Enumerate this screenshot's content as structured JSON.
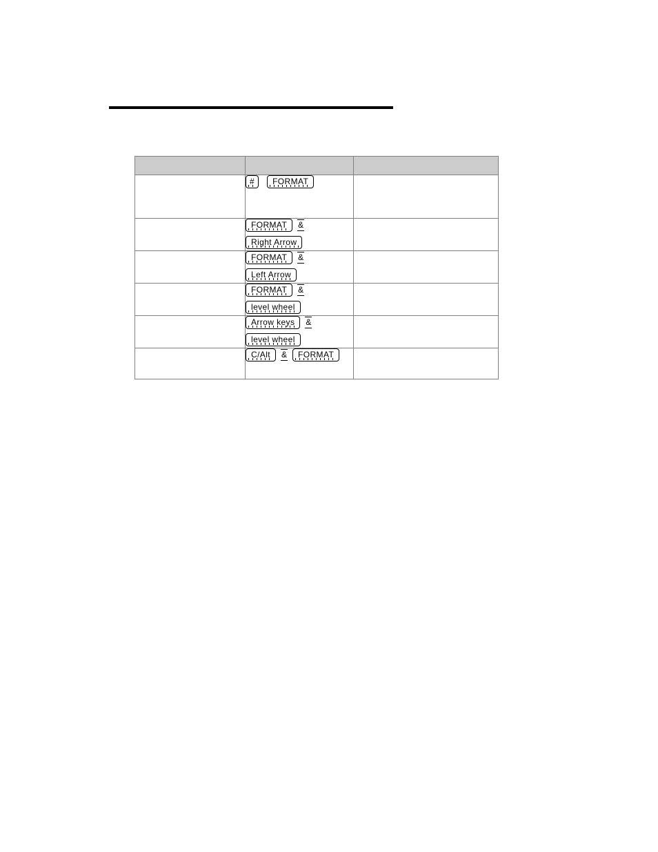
{
  "page": {
    "divider": "horizontal-rule"
  },
  "table": {
    "headers": [
      "",
      "",
      ""
    ],
    "rows": [
      {
        "action": "",
        "keys": [
          {
            "items": [
              {
                "type": "key",
                "label": "#"
              },
              {
                "type": "gap"
              },
              {
                "type": "key",
                "label": "FORMAT"
              }
            ]
          }
        ],
        "notes": "",
        "height": "tall"
      },
      {
        "action": "",
        "keys": [
          {
            "items": [
              {
                "type": "key",
                "label": "FORMAT"
              },
              {
                "type": "amp",
                "label": "&"
              }
            ]
          },
          {
            "items": [
              {
                "type": "key",
                "label": "Right Arrow"
              }
            ]
          }
        ],
        "notes": "",
        "height": "double"
      },
      {
        "action": "",
        "keys": [
          {
            "items": [
              {
                "type": "key",
                "label": "FORMAT"
              },
              {
                "type": "amp",
                "label": "&"
              }
            ]
          },
          {
            "items": [
              {
                "type": "key",
                "label": "Left Arrow"
              }
            ]
          }
        ],
        "notes": "",
        "height": "double"
      },
      {
        "action": "",
        "keys": [
          {
            "items": [
              {
                "type": "key",
                "label": "FORMAT"
              },
              {
                "type": "amp",
                "label": "&"
              }
            ]
          },
          {
            "items": [
              {
                "type": "key",
                "label": "level wheel"
              }
            ]
          }
        ],
        "notes": "",
        "height": "double"
      },
      {
        "action": "",
        "keys": [
          {
            "items": [
              {
                "type": "key",
                "label": "Arrow keys"
              },
              {
                "type": "amp",
                "label": "&"
              }
            ]
          },
          {
            "items": [
              {
                "type": "key",
                "label": "level wheel"
              }
            ]
          }
        ],
        "notes": "",
        "height": "double"
      },
      {
        "action": "",
        "keys": [
          {
            "items": [
              {
                "type": "key",
                "label": "C/Alt"
              },
              {
                "type": "amp",
                "label": "&"
              },
              {
                "type": "key",
                "label": "FORMAT"
              }
            ]
          }
        ],
        "notes": "",
        "height": "single"
      }
    ]
  },
  "colors": {
    "header_fill": "#cccccc",
    "border": "#808080",
    "rule": "#000000",
    "key_border": "#000000",
    "text": "#000000"
  }
}
